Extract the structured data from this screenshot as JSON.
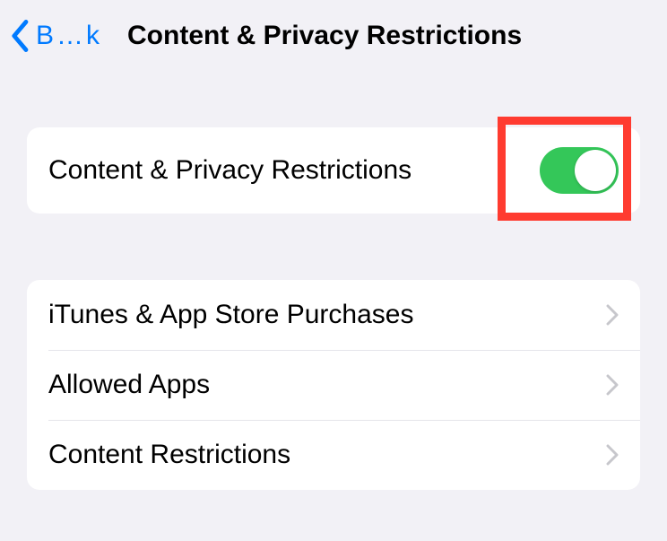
{
  "header": {
    "back_label": "B…k",
    "title": "Content & Privacy Restrictions"
  },
  "toggle_section": {
    "label": "Content & Privacy Restrictions",
    "enabled": true
  },
  "menu": {
    "items": [
      {
        "label": "iTunes & App Store Purchases"
      },
      {
        "label": "Allowed Apps"
      },
      {
        "label": "Content Restrictions"
      }
    ]
  }
}
